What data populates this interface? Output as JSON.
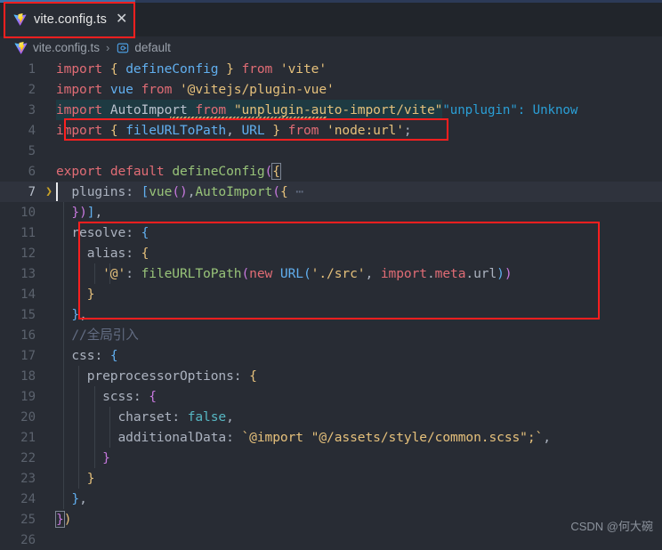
{
  "window": {
    "app": "Visual Studio Code",
    "theme_bg": "#282c34",
    "accent": "#3d6ea8"
  },
  "tab": {
    "label": "vite.config.ts",
    "close_label": "✕",
    "icon": "vite-logo-icon"
  },
  "breadcrumb": {
    "file": "vite.config.ts",
    "separator": "›",
    "symbol": "default",
    "symbol_icon": "⒤"
  },
  "editor": {
    "language": "typescript",
    "active_line": 7,
    "lines": [
      {
        "num": "1",
        "text": "import { defineConfig } from 'vite'"
      },
      {
        "num": "2",
        "text": "import vue from '@vitejs/plugin-vue'"
      },
      {
        "num": "3",
        "text": "import AutoImport from \"unplugin-auto-import/vite\"",
        "hint": "\"unplugin\": Unknow"
      },
      {
        "num": "4",
        "text": "import { fileURLToPath, URL } from 'node:url';"
      },
      {
        "num": "5",
        "text": ""
      },
      {
        "num": "6",
        "text": "export default defineConfig({"
      },
      {
        "num": "7",
        "text": "  plugins: [vue(),AutoImport({ ⋯"
      },
      {
        "num": "10",
        "text": "  })],"
      },
      {
        "num": "11",
        "text": "  resolve: {"
      },
      {
        "num": "12",
        "text": "    alias: {"
      },
      {
        "num": "13",
        "text": "      '@': fileURLToPath(new URL('./src', import.meta.url))"
      },
      {
        "num": "14",
        "text": "    }"
      },
      {
        "num": "15",
        "text": "  },"
      },
      {
        "num": "16",
        "text": "  //全局引入"
      },
      {
        "num": "17",
        "text": "  css: {"
      },
      {
        "num": "18",
        "text": "    preprocessorOptions: {"
      },
      {
        "num": "19",
        "text": "      scss: {"
      },
      {
        "num": "20",
        "text": "        charset: false,"
      },
      {
        "num": "21",
        "text": "        additionalData: `@import \"@/assets/style/common.scss\";`,"
      },
      {
        "num": "22",
        "text": "      }"
      },
      {
        "num": "23",
        "text": "    }"
      },
      {
        "num": "24",
        "text": "  },"
      },
      {
        "num": "25",
        "text": "})"
      },
      {
        "num": "26",
        "text": ""
      }
    ]
  },
  "annotations": {
    "box_color": "#ff1f1f",
    "boxes": [
      {
        "name": "tab-highlight"
      },
      {
        "name": "import-line-highlight"
      },
      {
        "name": "resolve-block-highlight"
      }
    ]
  },
  "watermark": {
    "text": "CSDN @何大碗"
  }
}
